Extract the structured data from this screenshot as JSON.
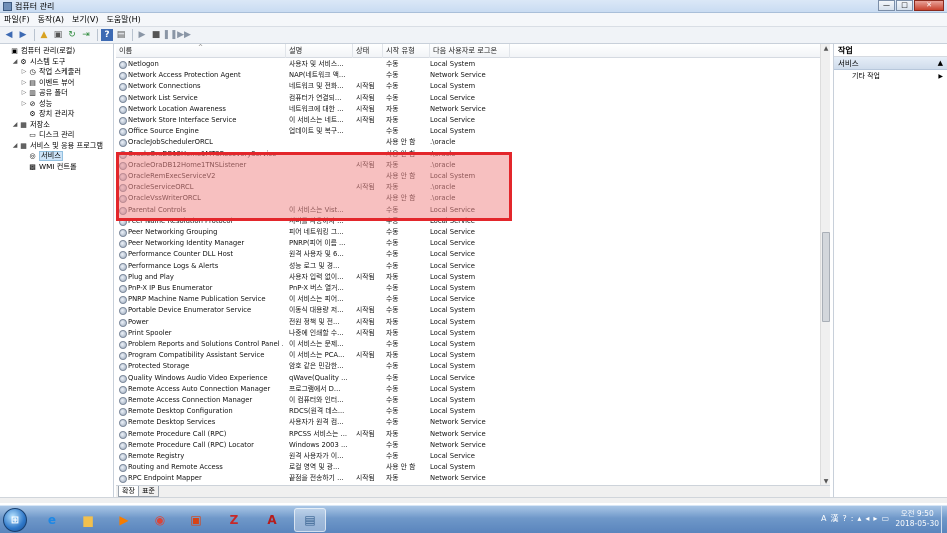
{
  "window": {
    "title": "컴퓨터 관리",
    "min": "—",
    "max": "□",
    "close": "✕"
  },
  "menu": [
    "파일(F)",
    "동작(A)",
    "보기(V)",
    "도움말(H)"
  ],
  "toolbar_icons": [
    "back-icon",
    "forward-icon",
    "up-icon",
    "show-hide-tree-icon",
    "refresh-icon",
    "export-icon",
    "help-icon",
    "properties-icon",
    "play-icon",
    "stop-icon",
    "pause-icon",
    "restart-icon"
  ],
  "tree": [
    {
      "label": "컴퓨터 관리(로컬)",
      "level": 0,
      "exp": "",
      "icon": "computer-icon",
      "glyph": "▣"
    },
    {
      "label": "시스템 도구",
      "level": 1,
      "exp": "◢",
      "icon": "tools-icon",
      "glyph": "⚙"
    },
    {
      "label": "작업 스케줄러",
      "level": 2,
      "exp": "▷",
      "icon": "clock-icon",
      "glyph": "◷"
    },
    {
      "label": "이벤트 뷰어",
      "level": 2,
      "exp": "▷",
      "icon": "event-viewer-icon",
      "glyph": "▤"
    },
    {
      "label": "공유 폴더",
      "level": 2,
      "exp": "▷",
      "icon": "shared-folder-icon",
      "glyph": "▥"
    },
    {
      "label": "성능",
      "level": 2,
      "exp": "▷",
      "icon": "performance-icon",
      "glyph": "⊘"
    },
    {
      "label": "장치 관리자",
      "level": 2,
      "exp": "",
      "icon": "device-manager-icon",
      "glyph": "⚙"
    },
    {
      "label": "저장소",
      "level": 1,
      "exp": "◢",
      "icon": "storage-icon",
      "glyph": "▦"
    },
    {
      "label": "디스크 관리",
      "level": 2,
      "exp": "",
      "icon": "disk-icon",
      "glyph": "▭"
    },
    {
      "label": "서비스 및 응용 프로그램",
      "level": 1,
      "exp": "◢",
      "icon": "services-apps-icon",
      "glyph": "▦"
    },
    {
      "label": "서비스",
      "level": 2,
      "exp": "",
      "icon": "services-icon",
      "glyph": "◎",
      "selected": true
    },
    {
      "label": "WMI 컨트롤",
      "level": 2,
      "exp": "",
      "icon": "wmi-icon",
      "glyph": "▩"
    }
  ],
  "columns": [
    "이름",
    "설명",
    "상태",
    "시작 유형",
    "다음 사용자로 로그온"
  ],
  "services": [
    [
      "Netlogon",
      "사용자 및 서비스...",
      "",
      "수동",
      "Local System"
    ],
    [
      "Network Access Protection Agent",
      "NAP(네트워크 액...",
      "",
      "수동",
      "Network Service"
    ],
    [
      "Network Connections",
      "네트워크 및 전화...",
      "시작됨",
      "수동",
      "Local System"
    ],
    [
      "Network List Service",
      "컴퓨터가 연결되...",
      "시작됨",
      "수동",
      "Local Service"
    ],
    [
      "Network Location Awareness",
      "네트워크에 대한 ...",
      "시작됨",
      "자동",
      "Network Service"
    ],
    [
      "Network Store Interface Service",
      "이 서비스는 네트...",
      "시작됨",
      "자동",
      "Local Service"
    ],
    [
      "Office Source Engine",
      "업데이트 및 복구...",
      "",
      "수동",
      "Local System"
    ],
    [
      "OracleJobSchedulerORCL",
      "",
      "",
      "사용 안 함",
      ".\\oracle"
    ],
    [
      "OracleOraDB12Home1MTSRecoveryService",
      "",
      "",
      "사용 안 함",
      ".\\oracle"
    ],
    [
      "OracleOraDB12Home1TNSListener",
      "",
      "시작됨",
      "자동",
      ".\\oracle"
    ],
    [
      "OracleRemExecServiceV2",
      "",
      "",
      "사용 안 함",
      "Local System"
    ],
    [
      "OracleServiceORCL",
      "",
      "시작됨",
      "자동",
      ".\\oracle"
    ],
    [
      "OracleVssWriterORCL",
      "",
      "",
      "사용 안 함",
      ".\\oracle"
    ],
    [
      "Parental Controls",
      "이 서비스는 Vist...",
      "",
      "수동",
      "Local Service"
    ],
    [
      "Peer Name Resolution Protocol",
      "서버를 사용하지 ...",
      "",
      "수동",
      "Local Service"
    ],
    [
      "Peer Networking Grouping",
      "피어 네트워킹 그...",
      "",
      "수동",
      "Local Service"
    ],
    [
      "Peer Networking Identity Manager",
      "PNRP(피어 이름 ...",
      "",
      "수동",
      "Local Service"
    ],
    [
      "Performance Counter DLL Host",
      "원격 사용자 및 6...",
      "",
      "수동",
      "Local Service"
    ],
    [
      "Performance Logs & Alerts",
      "성능 로그 및 경...",
      "",
      "수동",
      "Local Service"
    ],
    [
      "Plug and Play",
      "사용자 입력 없이...",
      "시작됨",
      "자동",
      "Local System"
    ],
    [
      "PnP-X IP Bus Enumerator",
      "PnP-X 버스 열거...",
      "",
      "수동",
      "Local System"
    ],
    [
      "PNRP Machine Name Publication Service",
      "이 서비스는 피어...",
      "",
      "수동",
      "Local Service"
    ],
    [
      "Portable Device Enumerator Service",
      "이동식 대용량 저...",
      "시작됨",
      "수동",
      "Local System"
    ],
    [
      "Power",
      "전원 정책 및 전...",
      "시작됨",
      "자동",
      "Local System"
    ],
    [
      "Print Spooler",
      "나중에 인쇄할 수...",
      "시작됨",
      "자동",
      "Local System"
    ],
    [
      "Problem Reports and Solutions Control Panel ...",
      "이 서비스는 문제...",
      "",
      "수동",
      "Local System"
    ],
    [
      "Program Compatibility Assistant Service",
      "이 서비스는 PCA...",
      "시작됨",
      "자동",
      "Local System"
    ],
    [
      "Protected Storage",
      "암호 같은 민감한...",
      "",
      "수동",
      "Local System"
    ],
    [
      "Quality Windows Audio Video Experience",
      "qWave(Quality ...",
      "",
      "수동",
      "Local Service"
    ],
    [
      "Remote Access Auto Connection Manager",
      "프로그램에서 D...",
      "",
      "수동",
      "Local System"
    ],
    [
      "Remote Access Connection Manager",
      "이 컴퓨터와 인터...",
      "",
      "수동",
      "Local System"
    ],
    [
      "Remote Desktop Configuration",
      "RDCS(원격 데스...",
      "",
      "수동",
      "Local System"
    ],
    [
      "Remote Desktop Services",
      "사용자가 원격 컴...",
      "",
      "수동",
      "Network Service"
    ],
    [
      "Remote Procedure Call (RPC)",
      "RPCSS 서비스는 ...",
      "시작됨",
      "자동",
      "Network Service"
    ],
    [
      "Remote Procedure Call (RPC) Locator",
      "Windows 2003 ...",
      "",
      "수동",
      "Network Service"
    ],
    [
      "Remote Registry",
      "원격 사용자가 이...",
      "",
      "수동",
      "Local Service"
    ],
    [
      "Routing and Remote Access",
      "로컬 영역 및 광...",
      "",
      "사용 안 함",
      "Local System"
    ],
    [
      "RPC Endpoint Mapper",
      "끝점을 전송하기 ...",
      "시작됨",
      "자동",
      "Network Service"
    ]
  ],
  "tabs": [
    "확장",
    "표준"
  ],
  "actions": {
    "header": "작업",
    "section": "서비스",
    "more": "기타 작업"
  },
  "taskbar": {
    "apps": [
      {
        "name": "explorer-taskbar-icon",
        "glyph": "e",
        "color": "#1e88e5"
      },
      {
        "name": "folder-taskbar-icon",
        "glyph": "▆",
        "color": "#f2c04d"
      },
      {
        "name": "media-player-taskbar-icon",
        "glyph": "▶",
        "color": "#f57c00"
      },
      {
        "name": "chrome-taskbar-icon",
        "glyph": "◉",
        "color": "#db4437"
      },
      {
        "name": "app-taskbar-icon",
        "glyph": "▣",
        "color": "#d84315"
      },
      {
        "name": "filezilla-taskbar-icon",
        "glyph": "Z",
        "color": "#c62828"
      },
      {
        "name": "pdf-taskbar-icon",
        "glyph": "A",
        "color": "#b71c1c"
      },
      {
        "name": "computer-management-taskbar-icon",
        "glyph": "▤",
        "color": "#37618f"
      }
    ],
    "tray": [
      "A",
      "漢",
      "?",
      ":",
      "▴",
      "◂",
      "▸",
      "▭"
    ],
    "time": "오전 9:50",
    "date": "2018-05-30"
  },
  "colors": {
    "highlight_border": "#e3262b",
    "selection": "#cde3f7"
  }
}
